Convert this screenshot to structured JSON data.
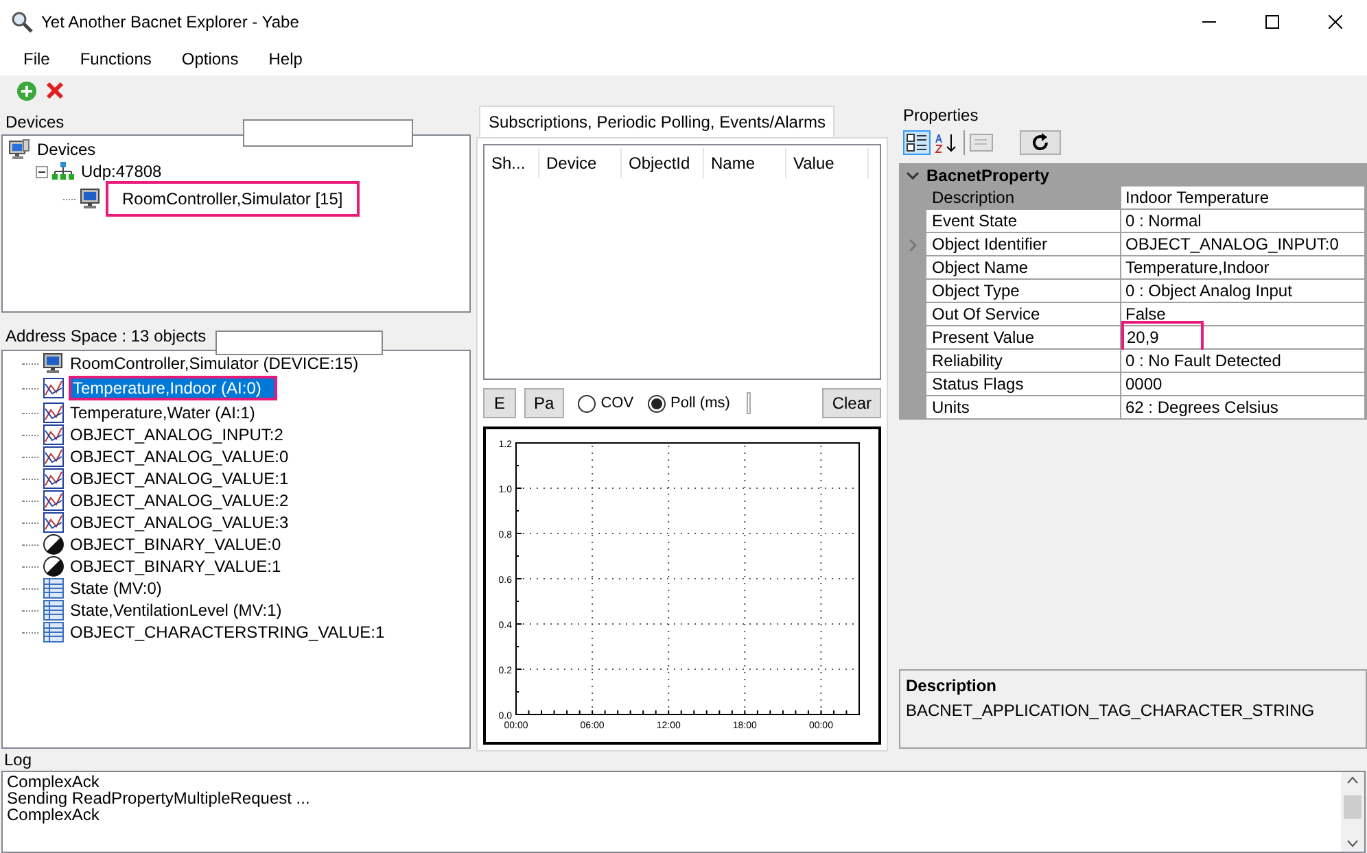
{
  "window": {
    "title": "Yet Another Bacnet Explorer - Yabe"
  },
  "menu": [
    "File",
    "Functions",
    "Options",
    "Help"
  ],
  "devices": {
    "title": "Devices",
    "tree": [
      {
        "label": "Devices",
        "kind": "root",
        "children": [
          {
            "label": "Udp:47808",
            "kind": "network",
            "expanded": true,
            "children": [
              {
                "label": "RoomController,Simulator [15]",
                "kind": "device",
                "highlighted": true
              }
            ]
          }
        ]
      }
    ]
  },
  "address_space": {
    "title": "Address Space : 13 objects",
    "items": [
      {
        "label": "RoomController,Simulator (DEVICE:15)",
        "kind": "device",
        "selected": false,
        "highlighted": false
      },
      {
        "label": "Temperature,Indoor (AI:0)",
        "kind": "analog",
        "selected": true,
        "highlighted": true
      },
      {
        "label": "Temperature,Water (AI:1)",
        "kind": "analog",
        "selected": false,
        "highlighted": false
      },
      {
        "label": "OBJECT_ANALOG_INPUT:2",
        "kind": "analog",
        "selected": false,
        "highlighted": false
      },
      {
        "label": "OBJECT_ANALOG_VALUE:0",
        "kind": "analog",
        "selected": false,
        "highlighted": false
      },
      {
        "label": "OBJECT_ANALOG_VALUE:1",
        "kind": "analog",
        "selected": false,
        "highlighted": false
      },
      {
        "label": "OBJECT_ANALOG_VALUE:2",
        "kind": "analog",
        "selected": false,
        "highlighted": false
      },
      {
        "label": "OBJECT_ANALOG_VALUE:3",
        "kind": "analog",
        "selected": false,
        "highlighted": false
      },
      {
        "label": "OBJECT_BINARY_VALUE:0",
        "kind": "binary",
        "selected": false,
        "highlighted": false
      },
      {
        "label": "OBJECT_BINARY_VALUE:1",
        "kind": "binary",
        "selected": false,
        "highlighted": false
      },
      {
        "label": "State (MV:0)",
        "kind": "multistate",
        "selected": false,
        "highlighted": false
      },
      {
        "label": "State,VentilationLevel (MV:1)",
        "kind": "multistate",
        "selected": false,
        "highlighted": false
      },
      {
        "label": "OBJECT_CHARACTERSTRING_VALUE:1",
        "kind": "multistate",
        "selected": false,
        "highlighted": false
      }
    ]
  },
  "subscriptions": {
    "tab": "Subscriptions, Periodic Polling, Events/Alarms",
    "columns": [
      "Sh...",
      "Device",
      "ObjectId",
      "Name",
      "Value"
    ],
    "buttons": [
      "E",
      "Pa"
    ],
    "modes": [
      {
        "label": "COV",
        "selected": false
      },
      {
        "label": "Poll (ms)",
        "selected": true
      }
    ],
    "clear": "Clear",
    "chart_data": {
      "type": "line",
      "grid": true,
      "ylim": [
        0,
        1.2
      ],
      "yticks": [
        {
          "value": 0,
          "label": "0.0"
        },
        {
          "value": 0.2,
          "label": "0.2"
        },
        {
          "value": 0.4,
          "label": "0.4"
        },
        {
          "value": 0.6,
          "label": "0.6"
        },
        {
          "value": 0.8,
          "label": "0.8"
        },
        {
          "value": 1,
          "label": "1.0"
        },
        {
          "value": 1.2,
          "label": "1.2"
        }
      ],
      "xlim": [
        0,
        27
      ],
      "xticks": [
        {
          "value": 0,
          "label": "00:00"
        },
        {
          "value": 6,
          "label": "06:00"
        },
        {
          "value": 12,
          "label": "12:00"
        },
        {
          "value": 18,
          "label": "18:00"
        },
        {
          "value": 24,
          "label": "00:00"
        }
      ]
    }
  },
  "properties": {
    "title": "Properties",
    "category": "BacnetProperty",
    "rows": [
      {
        "name": "Description",
        "value": "Indoor Temperature",
        "selected": true,
        "highlighted": false
      },
      {
        "name": "Event State",
        "value": "0 : Normal",
        "selected": false,
        "highlighted": false
      },
      {
        "name": "Object Identifier",
        "value": "OBJECT_ANALOG_INPUT:0",
        "selected": false,
        "highlighted": false
      },
      {
        "name": "Object Name",
        "value": "Temperature,Indoor",
        "selected": false,
        "highlighted": false
      },
      {
        "name": "Object Type",
        "value": "0 : Object Analog Input",
        "selected": false,
        "highlighted": false
      },
      {
        "name": "Out Of Service",
        "value": "False",
        "selected": false,
        "highlighted": false
      },
      {
        "name": "Present Value",
        "value": "20,9",
        "selected": false,
        "highlighted": true
      },
      {
        "name": "Reliability",
        "value": "0 : No Fault Detected",
        "selected": false,
        "highlighted": false
      },
      {
        "name": "Status Flags",
        "value": "0000",
        "selected": false,
        "highlighted": false
      },
      {
        "name": "Units",
        "value": "62 : Degrees Celsius",
        "selected": false,
        "highlighted": false
      }
    ],
    "help_title": "Description",
    "help_text": "BACNET_APPLICATION_TAG_CHARACTER_STRING"
  },
  "log": {
    "title": "Log",
    "lines": [
      "ComplexAck",
      "Sending ReadPropertyMultipleRequest ...",
      "ComplexAck"
    ]
  }
}
